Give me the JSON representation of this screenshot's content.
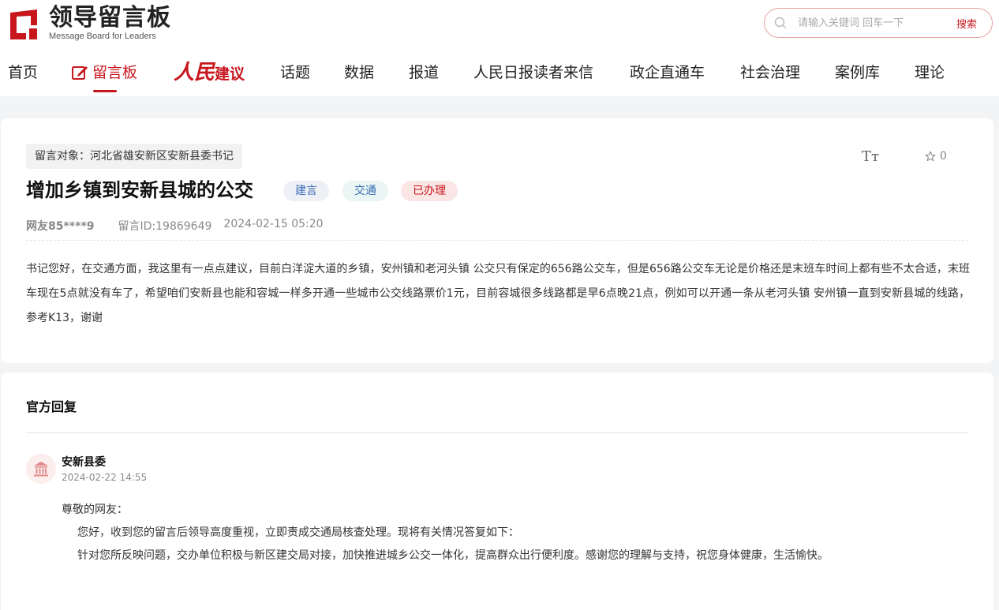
{
  "logo": {
    "title": "领导留言板",
    "subtitle": "Message Board for Leaders",
    "brand_color": "#c8161d"
  },
  "search": {
    "placeholder": "请输入关键词 回车一下",
    "button": "搜索"
  },
  "nav": {
    "items": [
      {
        "label": "首页"
      },
      {
        "label": "留言板",
        "active": true,
        "icon": "edit-icon"
      },
      {
        "label_script": "人民",
        "label": "建议"
      },
      {
        "label": "话题"
      },
      {
        "label": "数据"
      },
      {
        "label": "报道"
      },
      {
        "label": "人民日报读者来信"
      },
      {
        "label": "政企直通车"
      },
      {
        "label": "社会治理"
      },
      {
        "label": "案例库"
      },
      {
        "label": "理论"
      }
    ]
  },
  "message": {
    "target": "留言对象：河北省雄安新区安新县委书记",
    "title": "增加乡镇到安新县城的公交",
    "tags": [
      "建言",
      "交通",
      "已办理"
    ],
    "user": "网友85****9",
    "id": "留言ID:19869649",
    "time": "2024-02-15 05:20",
    "font_size_icon": "Tт",
    "favorites": "0",
    "content": "书记您好，在交通方面，我这里有一点点建议，目前白洋淀大道的乡镇，安州镇和老河头镇 公交只有保定的656路公交车，但是656路公交车无论是价格还是末班车时间上都有些不太合适，末班车现在5点就没有车了，希望咱们安新县也能和容城一样多开通一些城市公交线路票价1元，目前容城很多线路都是早6点晚21点，例如可以开通一条从老河头镇 安州镇一直到安新县城的线路，参考K13，谢谢"
  },
  "reply": {
    "heading": "官方回复",
    "replier": "安新县委",
    "time": "2024-02-22 14:55",
    "greeting": "尊敬的网友：",
    "paragraphs": [
      "您好，收到您的留言后领导高度重视，立即责成交通局核查处理。现将有关情况答复如下：",
      "针对您所反映问题，交办单位积极与新区建交局对接，加快推进城乡公交一体化，提高群众出行便利度。感谢您的理解与支持，祝您身体健康，生活愉快。"
    ]
  }
}
